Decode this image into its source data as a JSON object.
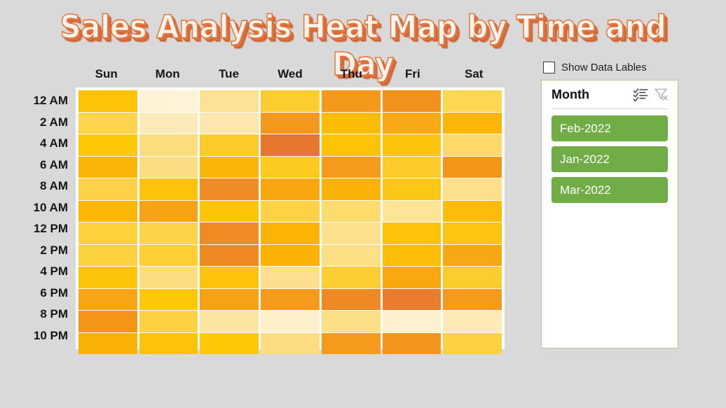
{
  "title": "Sales Analysis Heat Map by Time and Day",
  "controls": {
    "show_data_labels_label": "Show Data Lables",
    "show_data_labels_checked": false
  },
  "slicer": {
    "title": "Month",
    "multiselect_icon": "multi-select-icon",
    "clear_filter_icon": "clear-filter-icon",
    "items": [
      {
        "label": "Feb-2022",
        "selected": true
      },
      {
        "label": "Jan-2022",
        "selected": true
      },
      {
        "label": "Mar-2022",
        "selected": true
      }
    ],
    "selected_color": "#70ad47",
    "border_color": "#a9cf8f"
  },
  "chart_data": {
    "type": "heatmap",
    "title": "Sales Analysis Heat Map by Time and Day",
    "xlabel": "",
    "ylabel": "",
    "grid": false,
    "legend": "none",
    "colorscale": [
      "#fdf3dc",
      "#ffc000",
      "#e8772e"
    ],
    "categories": [
      "Sun",
      "Mon",
      "Tue",
      "Wed",
      "Thu",
      "Fri",
      "Sat"
    ],
    "rows": [
      "12 AM",
      "2 AM",
      "4 AM",
      "6 AM",
      "8 AM",
      "10 AM",
      "12 PM",
      "2 PM",
      "4 PM",
      "6 PM",
      "8 PM",
      "10 PM"
    ],
    "cells": [
      [
        {
          "color": "#fdc306",
          "value": 0.78
        },
        {
          "color": "#fef3d6",
          "value": 0.08
        },
        {
          "color": "#fde194",
          "value": 0.42
        },
        {
          "color": "#fdcd2f",
          "value": 0.68
        },
        {
          "color": "#f5991d",
          "value": 0.88
        },
        {
          "color": "#f2911c",
          "value": 0.92
        },
        {
          "color": "#fdd652",
          "value": 0.55
        }
      ],
      [
        {
          "color": "#fdd44c",
          "value": 0.57
        },
        {
          "color": "#fdeabb",
          "value": 0.24
        },
        {
          "color": "#fde7ae",
          "value": 0.3
        },
        {
          "color": "#f5991d",
          "value": 0.88
        },
        {
          "color": "#fcbb07",
          "value": 0.8
        },
        {
          "color": "#f9a913",
          "value": 0.84
        },
        {
          "color": "#fbb609",
          "value": 0.81
        }
      ],
      [
        {
          "color": "#fdc906",
          "value": 0.75
        },
        {
          "color": "#fddd7e",
          "value": 0.47
        },
        {
          "color": "#fdcb28",
          "value": 0.69
        },
        {
          "color": "#e8772e",
          "value": 1.0
        },
        {
          "color": "#fdc406",
          "value": 0.77
        },
        {
          "color": "#fdc50a",
          "value": 0.76
        },
        {
          "color": "#fdd96a",
          "value": 0.52
        }
      ],
      [
        {
          "color": "#fbb509",
          "value": 0.82
        },
        {
          "color": "#fddd84",
          "value": 0.46
        },
        {
          "color": "#fbb50a",
          "value": 0.82
        },
        {
          "color": "#fdca1f",
          "value": 0.7
        },
        {
          "color": "#f59a1d",
          "value": 0.87
        },
        {
          "color": "#fdcc2b",
          "value": 0.68
        },
        {
          "color": "#f49519",
          "value": 0.89
        }
      ],
      [
        {
          "color": "#fdd249",
          "value": 0.59
        },
        {
          "color": "#fdc20a",
          "value": 0.78
        },
        {
          "color": "#f08c24",
          "value": 0.94
        },
        {
          "color": "#f9a60f",
          "value": 0.85
        },
        {
          "color": "#fbb207",
          "value": 0.83
        },
        {
          "color": "#fdc718",
          "value": 0.73
        },
        {
          "color": "#fddf8c",
          "value": 0.44
        }
      ],
      [
        {
          "color": "#fcb706",
          "value": 0.81
        },
        {
          "color": "#f7a217",
          "value": 0.86
        },
        {
          "color": "#fdc408",
          "value": 0.77
        },
        {
          "color": "#fdd345",
          "value": 0.6
        },
        {
          "color": "#fddc6d",
          "value": 0.5
        },
        {
          "color": "#fde496",
          "value": 0.39
        },
        {
          "color": "#fcbc09",
          "value": 0.8
        }
      ],
      [
        {
          "color": "#fdd13c",
          "value": 0.62
        },
        {
          "color": "#fdd449",
          "value": 0.58
        },
        {
          "color": "#ef8b22",
          "value": 0.95
        },
        {
          "color": "#fbb406",
          "value": 0.82
        },
        {
          "color": "#fde08d",
          "value": 0.44
        },
        {
          "color": "#fdc20a",
          "value": 0.78
        },
        {
          "color": "#fdc511",
          "value": 0.76
        }
      ],
      [
        {
          "color": "#fdd240",
          "value": 0.61
        },
        {
          "color": "#fdcf35",
          "value": 0.64
        },
        {
          "color": "#ee8922",
          "value": 0.96
        },
        {
          "color": "#fbb105",
          "value": 0.83
        },
        {
          "color": "#fddf86",
          "value": 0.45
        },
        {
          "color": "#fcbe09",
          "value": 0.79
        },
        {
          "color": "#f8a714",
          "value": 0.85
        }
      ],
      [
        {
          "color": "#fdc50a",
          "value": 0.76
        },
        {
          "color": "#fddd80",
          "value": 0.47
        },
        {
          "color": "#fdc30a",
          "value": 0.78
        },
        {
          "color": "#fde08f",
          "value": 0.43
        },
        {
          "color": "#fdce33",
          "value": 0.65
        },
        {
          "color": "#f9a80f",
          "value": 0.84
        },
        {
          "color": "#fdcd2e",
          "value": 0.67
        }
      ],
      [
        {
          "color": "#f8a415",
          "value": 0.86
        },
        {
          "color": "#fdc807",
          "value": 0.75
        },
        {
          "color": "#f7a116",
          "value": 0.86
        },
        {
          "color": "#f59a1c",
          "value": 0.88
        },
        {
          "color": "#ee8924",
          "value": 0.96
        },
        {
          "color": "#e97c2d",
          "value": 0.99
        },
        {
          "color": "#f59a1c",
          "value": 0.88
        }
      ],
      [
        {
          "color": "#f49518",
          "value": 0.89
        },
        {
          "color": "#fdd142",
          "value": 0.62
        },
        {
          "color": "#fde5a0",
          "value": 0.36
        },
        {
          "color": "#fef0cb",
          "value": 0.18
        },
        {
          "color": "#fddf88",
          "value": 0.45
        },
        {
          "color": "#fef1ce",
          "value": 0.16
        },
        {
          "color": "#fdeab6",
          "value": 0.26
        }
      ],
      [
        {
          "color": "#fbb206",
          "value": 0.83
        },
        {
          "color": "#fdc20a",
          "value": 0.78
        },
        {
          "color": "#fdc806",
          "value": 0.75
        },
        {
          "color": "#fddd80",
          "value": 0.47
        },
        {
          "color": "#f59a1d",
          "value": 0.88
        },
        {
          "color": "#f4941c",
          "value": 0.89
        },
        {
          "color": "#fdd144",
          "value": 0.61
        }
      ]
    ]
  }
}
